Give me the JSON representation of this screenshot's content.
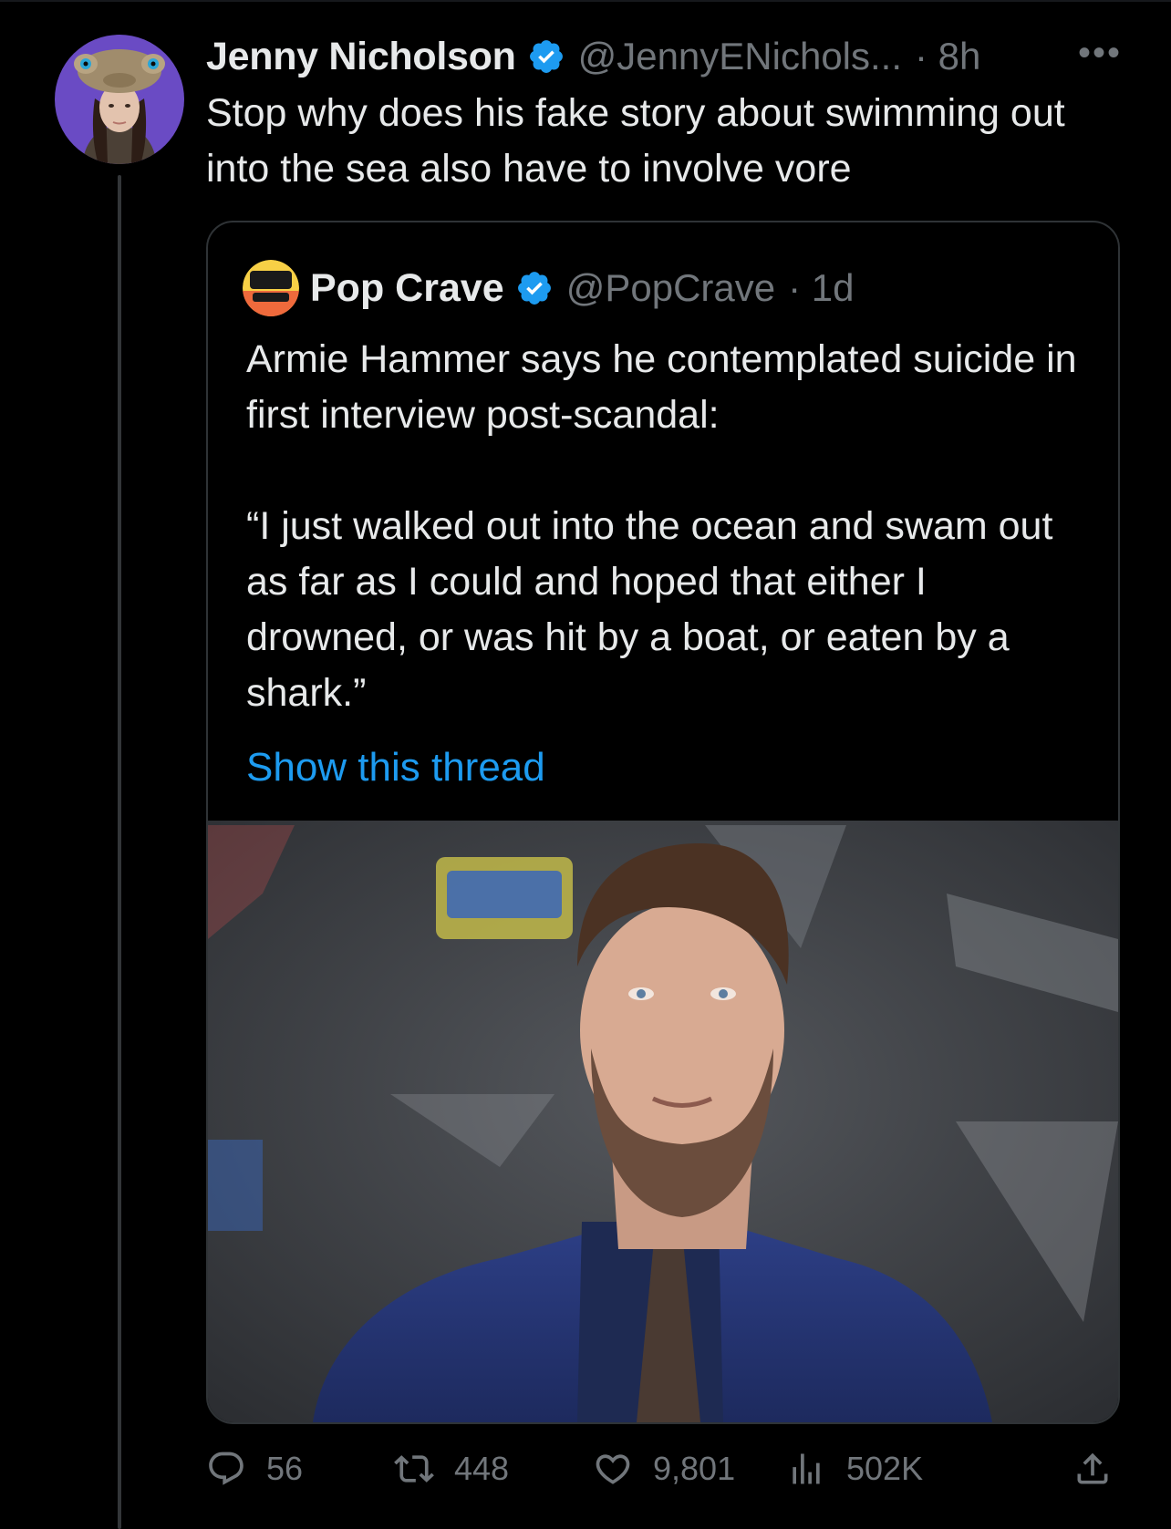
{
  "tweet": {
    "author_name": "Jenny Nicholson",
    "handle": "@JennyENichols...",
    "time": "· 8h",
    "more_label": "•••",
    "text": "Stop why does his fake story about swimming out into the sea also have to involve vore"
  },
  "quoted_tweet": {
    "author_name": "Pop Crave",
    "handle": "@PopCrave",
    "time": "· 1d",
    "text": "Armie Hammer says he contemplated suicide in first interview post-scandal:\n\n“I just walked out into the ocean and swam out as far as I could and hoped that either I drowned, or was hit by a boat, or eaten by a shark.”",
    "show_thread": "Show this thread"
  },
  "actions": {
    "replies": "56",
    "retweets": "448",
    "likes": "9,801",
    "views": "502K"
  },
  "colors": {
    "background": "#000000",
    "text": "#e7e9ea",
    "secondary": "#71767b",
    "link": "#1d9bf0",
    "verified": "#1d9bf0",
    "border": "#2f3336"
  },
  "icons": {
    "verified": "verified-badge-icon",
    "reply": "reply-icon",
    "retweet": "retweet-icon",
    "like": "heart-icon",
    "views": "views-icon",
    "share": "share-icon"
  }
}
